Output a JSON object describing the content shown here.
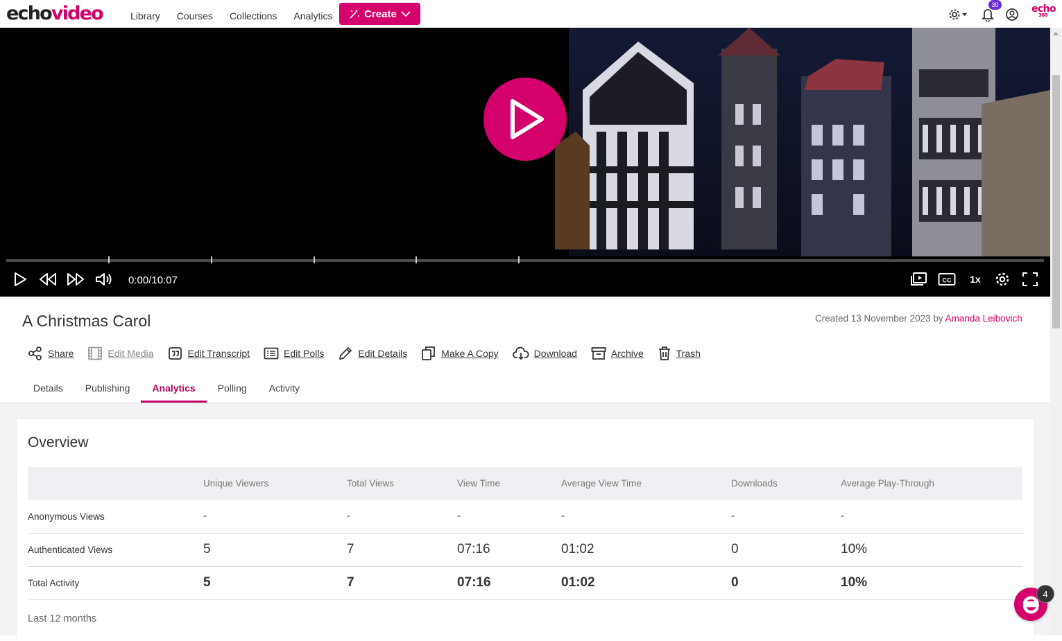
{
  "brand": {
    "part1": "echo",
    "part2": "video"
  },
  "nav": {
    "links": [
      "Library",
      "Courses",
      "Collections",
      "Analytics"
    ],
    "create_label": "Create"
  },
  "header_icons": {
    "settings": "gear-icon",
    "notifications": "bell-icon",
    "notification_count": "30",
    "account": "user-circle-icon",
    "logo_text": "echo",
    "logo_sub": "360"
  },
  "player": {
    "timecode": "0:00/10:07",
    "progress": 0,
    "speed_label": "1x",
    "controls": [
      "play-icon",
      "rewind-icon",
      "fast-forward-icon",
      "volume-icon",
      "media-view-icon",
      "closed-captions-icon",
      "settings-icon",
      "fullscreen-icon"
    ]
  },
  "media": {
    "title": "A Christmas Carol",
    "created_prefix": "Created 13 November 2023 by ",
    "author": "Amanda Leibovich"
  },
  "actions": [
    {
      "label": "Share",
      "icon": "share-icon",
      "enabled": true
    },
    {
      "label": "Edit Media",
      "icon": "film-icon",
      "enabled": false
    },
    {
      "label": "Edit Transcript",
      "icon": "quote-icon",
      "enabled": true
    },
    {
      "label": "Edit Polls",
      "icon": "list-icon",
      "enabled": true
    },
    {
      "label": "Edit Details",
      "icon": "pencil-icon",
      "enabled": true
    },
    {
      "label": "Make A Copy",
      "icon": "copy-icon",
      "enabled": true
    },
    {
      "label": "Download",
      "icon": "cloud-download-icon",
      "enabled": true
    },
    {
      "label": "Archive",
      "icon": "archive-icon",
      "enabled": true
    },
    {
      "label": "Trash",
      "icon": "trash-icon",
      "enabled": true
    }
  ],
  "tabs": [
    "Details",
    "Publishing",
    "Analytics",
    "Polling",
    "Activity"
  ],
  "active_tab": "Analytics",
  "overview": {
    "title": "Overview",
    "columns": [
      "",
      "Unique Viewers",
      "Total Views",
      "View Time",
      "Average View Time",
      "Downloads",
      "Average Play-Through"
    ],
    "rows": [
      {
        "label": "Anonymous Views",
        "values": [
          "-",
          "-",
          "-",
          "-",
          "-",
          "-"
        ]
      },
      {
        "label": "Authenticated Views",
        "values": [
          "5",
          "7",
          "07:16",
          "01:02",
          "0",
          "10%"
        ]
      },
      {
        "label": "Total Activity",
        "values": [
          "5",
          "7",
          "07:16",
          "01:02",
          "0",
          "10%"
        ]
      }
    ],
    "period": "Last 12 months"
  },
  "chat": {
    "count": "4"
  },
  "colors": {
    "accent": "#d4006c",
    "badge": "#6c2bd9"
  }
}
